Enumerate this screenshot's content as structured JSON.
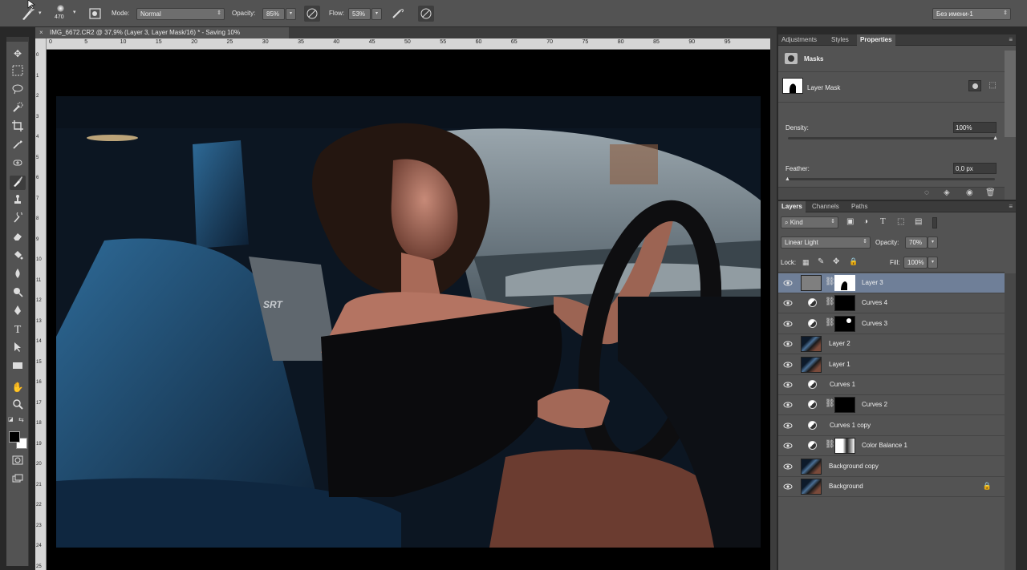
{
  "options_bar": {
    "brush_size": "470",
    "mode_label": "Mode:",
    "mode_value": "Normal",
    "opacity_label": "Opacity:",
    "opacity_value": "85%",
    "flow_label": "Flow:",
    "flow_value": "53%",
    "workspace_value": "Без имени-1"
  },
  "document": {
    "tab_title": "IMG_6672.CR2 @ 37,9% (Layer 3, Layer Mask/16) * - Saving 10%",
    "ruler_h": [
      "0",
      "5",
      "10",
      "15",
      "20",
      "25",
      "30",
      "35",
      "40",
      "45",
      "50",
      "55",
      "60",
      "65",
      "70",
      "75",
      "80",
      "85",
      "90",
      "95"
    ],
    "ruler_v": [
      "0",
      "1",
      "2",
      "3",
      "4",
      "5",
      "6",
      "7",
      "8",
      "9",
      "10",
      "11",
      "12",
      "13",
      "14",
      "15",
      "16",
      "17",
      "18",
      "19",
      "20",
      "21",
      "22",
      "23",
      "24",
      "25"
    ],
    "photo_text": "SRT"
  },
  "properties_panel": {
    "tabs": [
      "Adjustments",
      "Styles",
      "Properties"
    ],
    "active_tab": "Properties",
    "title": "Masks",
    "mask_name": "Layer Mask",
    "density_label": "Density:",
    "density_value": "100%",
    "feather_label": "Feather:",
    "feather_value": "0,0 px"
  },
  "layers_panel": {
    "tabs": [
      "Layers",
      "Channels",
      "Paths"
    ],
    "active_tab": "Layers",
    "filter_kind": "Kind",
    "blend_mode": "Linear Light",
    "opacity_label": "Opacity:",
    "opacity_value": "70%",
    "lock_label": "Lock:",
    "fill_label": "Fill:",
    "fill_value": "100%",
    "layers": [
      {
        "name": "Layer 3",
        "type": "pixel-mask",
        "selected": true
      },
      {
        "name": "Curves 4",
        "type": "adjust-mask",
        "selected": false
      },
      {
        "name": "Curves 3",
        "type": "adjust-mask",
        "selected": false
      },
      {
        "name": "Layer 2",
        "type": "pixel",
        "selected": false
      },
      {
        "name": "Layer 1",
        "type": "pixel",
        "selected": false
      },
      {
        "name": "Curves 1",
        "type": "adjust",
        "selected": false
      },
      {
        "name": "Curves 2",
        "type": "adjust-mask",
        "selected": false
      },
      {
        "name": "Curves 1 copy",
        "type": "adjust",
        "selected": false
      },
      {
        "name": "Color Balance 1",
        "type": "adjust-mask",
        "selected": false
      },
      {
        "name": "Background copy",
        "type": "pixel",
        "selected": false
      },
      {
        "name": "Background",
        "type": "pixel-locked",
        "selected": false
      }
    ]
  },
  "colors": {
    "ui_panel": "#535353",
    "ui_dark": "#3b3b3b",
    "selected_layer": "#6f7f98",
    "ruler": "#d6d6d6"
  }
}
